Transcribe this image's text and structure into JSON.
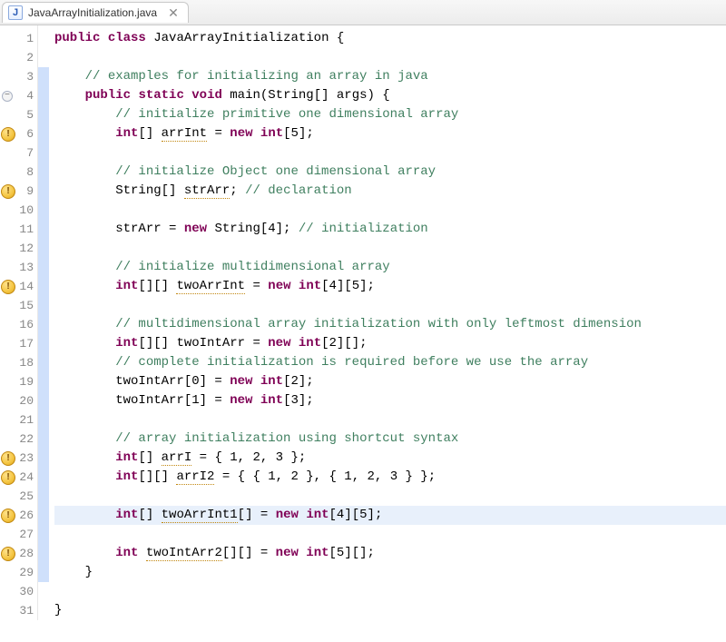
{
  "tab": {
    "filename": "JavaArrayInitialization.java"
  },
  "lines": [
    {
      "n": 1,
      "cov": "",
      "mark": "",
      "html": "<span class='kw'>public</span> <span class='kw'>class</span> JavaArrayInitialization {"
    },
    {
      "n": 2,
      "cov": "",
      "mark": "",
      "html": ""
    },
    {
      "n": 3,
      "cov": "blue",
      "mark": "",
      "html": "    <span class='cmt'>// examples for initializing an array in java</span>"
    },
    {
      "n": 4,
      "cov": "blue",
      "mark": "fold",
      "html": "    <span class='kw'>public</span> <span class='kw'>static</span> <span class='kw'>void</span> main(String[] args) {"
    },
    {
      "n": 5,
      "cov": "blue",
      "mark": "",
      "html": "        <span class='cmt'>// initialize primitive one dimensional array</span>"
    },
    {
      "n": 6,
      "cov": "blue",
      "mark": "warn",
      "html": "        <span class='kw'>int</span>[] <span class='warnU'>arrInt</span> = <span class='kw'>new</span> <span class='kw'>int</span>[5];"
    },
    {
      "n": 7,
      "cov": "blue",
      "mark": "",
      "html": ""
    },
    {
      "n": 8,
      "cov": "blue",
      "mark": "",
      "html": "        <span class='cmt'>// initialize Object one dimensional array</span>"
    },
    {
      "n": 9,
      "cov": "blue",
      "mark": "warn",
      "html": "        String[] <span class='warnU'>strArr</span>; <span class='cmt'>// declaration</span>"
    },
    {
      "n": 10,
      "cov": "blue",
      "mark": "",
      "html": ""
    },
    {
      "n": 11,
      "cov": "blue",
      "mark": "",
      "html": "        strArr = <span class='kw'>new</span> String[4]; <span class='cmt'>// initialization</span>"
    },
    {
      "n": 12,
      "cov": "blue",
      "mark": "",
      "html": ""
    },
    {
      "n": 13,
      "cov": "blue",
      "mark": "",
      "html": "        <span class='cmt'>// initialize multidimensional array</span>"
    },
    {
      "n": 14,
      "cov": "blue",
      "mark": "warn",
      "html": "        <span class='kw'>int</span>[][] <span class='warnU'>twoArrInt</span> = <span class='kw'>new</span> <span class='kw'>int</span>[4][5];"
    },
    {
      "n": 15,
      "cov": "blue",
      "mark": "",
      "html": ""
    },
    {
      "n": 16,
      "cov": "blue",
      "mark": "",
      "html": "        <span class='cmt'>// multidimensional array initialization with only leftmost dimension</span>"
    },
    {
      "n": 17,
      "cov": "blue",
      "mark": "",
      "html": "        <span class='kw'>int</span>[][] twoIntArr = <span class='kw'>new</span> <span class='kw'>int</span>[2][];"
    },
    {
      "n": 18,
      "cov": "blue",
      "mark": "",
      "html": "        <span class='cmt'>// complete initialization is required before we use the array</span>"
    },
    {
      "n": 19,
      "cov": "blue",
      "mark": "",
      "html": "        twoIntArr[0] = <span class='kw'>new</span> <span class='kw'>int</span>[2];"
    },
    {
      "n": 20,
      "cov": "blue",
      "mark": "",
      "html": "        twoIntArr[1] = <span class='kw'>new</span> <span class='kw'>int</span>[3];"
    },
    {
      "n": 21,
      "cov": "blue",
      "mark": "",
      "html": ""
    },
    {
      "n": 22,
      "cov": "blue",
      "mark": "",
      "html": "        <span class='cmt'>// array initialization using shortcut syntax</span>"
    },
    {
      "n": 23,
      "cov": "blue",
      "mark": "warn",
      "html": "        <span class='kw'>int</span>[] <span class='warnU'>arrI</span> = { 1, 2, 3 };"
    },
    {
      "n": 24,
      "cov": "blue",
      "mark": "warn",
      "html": "        <span class='kw'>int</span>[][] <span class='warnU'>arrI2</span> = { { 1, 2 }, { 1, 2, 3 } };"
    },
    {
      "n": 25,
      "cov": "blue",
      "mark": "",
      "html": ""
    },
    {
      "n": 26,
      "cov": "blue",
      "mark": "warn",
      "hl": true,
      "html": "        <span class='kw'>int</span>[] <span class='warnU'>twoArrInt1</span>[] = <span class='kw'>new</span> <span class='kw'>int</span>[4][5];"
    },
    {
      "n": 27,
      "cov": "blue",
      "mark": "",
      "html": ""
    },
    {
      "n": 28,
      "cov": "blue",
      "mark": "warn",
      "html": "        <span class='kw'>int</span> <span class='warnU'>twoIntArr2</span>[][] = <span class='kw'>new</span> <span class='kw'>int</span>[5][];"
    },
    {
      "n": 29,
      "cov": "blue",
      "mark": "",
      "html": "    }"
    },
    {
      "n": 30,
      "cov": "",
      "mark": "",
      "html": ""
    },
    {
      "n": 31,
      "cov": "",
      "mark": "",
      "html": "}"
    }
  ]
}
